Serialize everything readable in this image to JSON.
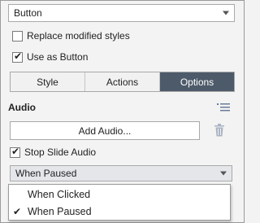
{
  "style_select": {
    "value": "Button"
  },
  "options": {
    "replace_modified": {
      "label": "Replace modified styles",
      "checked": false
    },
    "use_as_button": {
      "label": "Use as Button",
      "checked": true
    }
  },
  "tabs": [
    {
      "label": "Style",
      "active": false
    },
    {
      "label": "Actions",
      "active": false
    },
    {
      "label": "Options",
      "active": true
    }
  ],
  "audio": {
    "title": "Audio",
    "add_label": "Add Audio...",
    "stop_slide_audio": {
      "label": "Stop Slide Audio",
      "checked": true
    },
    "when_select": {
      "value": "When Paused"
    },
    "dropdown_options": [
      {
        "label": "When Clicked",
        "selected": false
      },
      {
        "label": "When Paused",
        "selected": true
      }
    ]
  },
  "colors": {
    "active_tab": "#4d5a6a",
    "trash_icon": "#aab4c4"
  }
}
